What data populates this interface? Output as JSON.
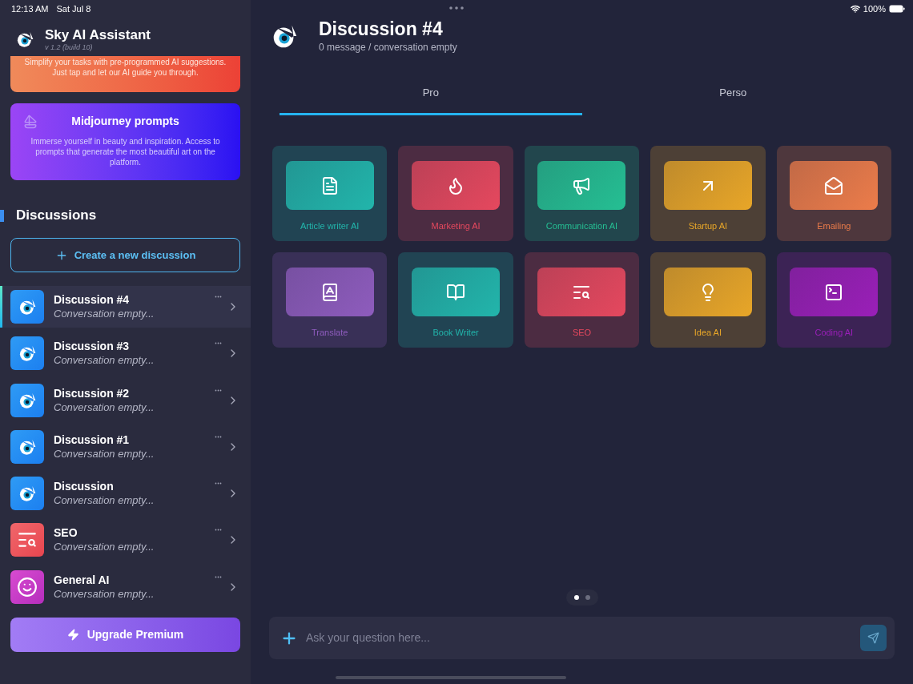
{
  "status_bar": {
    "time": "12:13 AM",
    "date": "Sat Jul 8",
    "battery": "100%"
  },
  "sidebar": {
    "app_name": "Sky AI Assistant",
    "version": "v 1.2 (build 10)",
    "promo_cards": [
      {
        "kind": "suggestions",
        "description": "Simplify your tasks with pre-programmed AI suggestions. Just tap and let our AI guide you through."
      },
      {
        "kind": "midjourney",
        "title": "Midjourney prompts",
        "description": "Immerse yourself in beauty and inspiration. Access to prompts that generate the most beautiful art on the platform."
      }
    ],
    "section_title": "Discussions",
    "create_button": "Create a new discussion",
    "discussions": [
      {
        "kind": "eye",
        "title": "Discussion #4",
        "subtitle": "Conversation empty...",
        "selected": true
      },
      {
        "kind": "eye",
        "title": "Discussion #3",
        "subtitle": "Conversation empty...",
        "selected": false
      },
      {
        "kind": "eye",
        "title": "Discussion #2",
        "subtitle": "Conversation empty...",
        "selected": false
      },
      {
        "kind": "eye",
        "title": "Discussion #1",
        "subtitle": "Conversation empty...",
        "selected": false
      },
      {
        "kind": "eye",
        "title": "Discussion",
        "subtitle": "Conversation empty...",
        "selected": false
      },
      {
        "kind": "seo",
        "title": "SEO",
        "subtitle": "Conversation empty...",
        "selected": false
      },
      {
        "kind": "smile",
        "title": "General AI",
        "subtitle": "Conversation empty...",
        "selected": false
      }
    ],
    "upgrade_button": "Upgrade Premium"
  },
  "header": {
    "title": "Discussion #4",
    "subtitle": "0 message / conversation empty"
  },
  "tabs": [
    {
      "label": "Pro",
      "selected": true
    },
    {
      "label": "Perso",
      "selected": false
    }
  ],
  "tiles": [
    {
      "kind": "document",
      "label": "Article writer AI",
      "color": "#22b5ab"
    },
    {
      "kind": "flame",
      "label": "Marketing AI",
      "color": "#e5485e"
    },
    {
      "kind": "megaphone",
      "label": "Communication AI",
      "color": "#25bf93"
    },
    {
      "kind": "arrow",
      "label": "Startup AI",
      "color": "#e8a628"
    },
    {
      "kind": "mail",
      "label": "Emailing",
      "color": "#ec7c4a"
    },
    {
      "kind": "book-lang",
      "label": "Translate",
      "color": "#8e5cbd"
    },
    {
      "kind": "book",
      "label": "Book Writer",
      "color": "#22b5ab"
    },
    {
      "kind": "search",
      "label": "SEO",
      "color": "#e5485e"
    },
    {
      "kind": "bulb",
      "label": "Idea AI",
      "color": "#e8a628"
    },
    {
      "kind": "terminal",
      "label": "Coding AI",
      "color": "#9a1fb8"
    }
  ],
  "pages": [
    {
      "selected": true
    },
    {
      "selected": false
    }
  ],
  "composer": {
    "placeholder": "Ask your question here..."
  }
}
